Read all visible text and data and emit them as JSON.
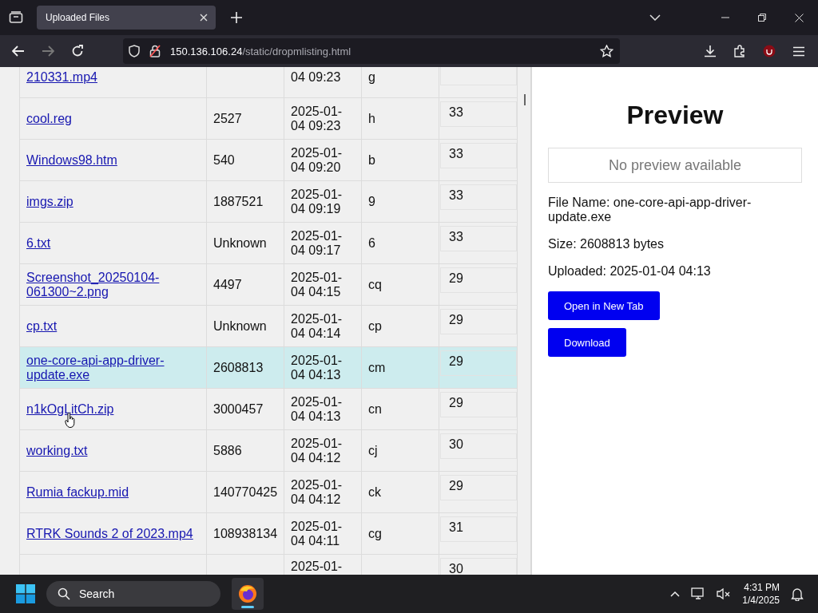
{
  "browser": {
    "tab_title": "Uploaded Files",
    "url_host": "150.136.106.24",
    "url_path": "/static/dropmlisting.html"
  },
  "table": {
    "rows": [
      {
        "name": "210331.mp4",
        "size": "",
        "date": "04 09:23",
        "type": "g",
        "count": "",
        "selected": false
      },
      {
        "name": "cool.reg",
        "size": "2527",
        "date": "2025-01-04 09:23",
        "type": "h",
        "count": "33",
        "selected": false
      },
      {
        "name": "Windows98.htm",
        "size": "540",
        "date": "2025-01-04 09:20",
        "type": "b",
        "count": "33",
        "selected": false
      },
      {
        "name": "imgs.zip",
        "size": "1887521",
        "date": "2025-01-04 09:19",
        "type": "9",
        "count": "33",
        "selected": false
      },
      {
        "name": "6.txt",
        "size": "Unknown",
        "date": "2025-01-04 09:17",
        "type": "6",
        "count": "33",
        "selected": false
      },
      {
        "name": "Screenshot_20250104-061300~2.png",
        "size": "4497",
        "date": "2025-01-04 04:15",
        "type": "cq",
        "count": "29",
        "selected": false
      },
      {
        "name": "cp.txt",
        "size": "Unknown",
        "date": "2025-01-04 04:14",
        "type": "cp",
        "count": "29",
        "selected": false
      },
      {
        "name": "one-core-api-app-driver-update.exe",
        "size": "2608813",
        "date": "2025-01-04 04:13",
        "type": "cm",
        "count": "29",
        "selected": true
      },
      {
        "name": "n1kOgLitCh.zip",
        "size": "3000457",
        "date": "2025-01-04 04:13",
        "type": "cn",
        "count": "29",
        "selected": false
      },
      {
        "name": "working.txt",
        "size": "5886",
        "date": "2025-01-04 04:12",
        "type": "cj",
        "count": "30",
        "selected": false
      },
      {
        "name": "Rumia fackup.mid",
        "size": "140770425",
        "date": "2025-01-04 04:12",
        "type": "ck",
        "count": "29",
        "selected": false
      },
      {
        "name": "RTRK Sounds 2 of 2023.mp4",
        "size": "108938134",
        "date": "2025-01-04 04:11",
        "type": "cg",
        "count": "31",
        "selected": false
      },
      {
        "name": "",
        "size": "",
        "date": "2025-01-",
        "type": "",
        "count": "30",
        "selected": false
      }
    ]
  },
  "preview": {
    "title": "Preview",
    "placeholder": "No preview available",
    "file_name": "File Name: one-core-api-app-driver-update.exe",
    "size": "Size: 2608813 bytes",
    "uploaded": "Uploaded: 2025-01-04 04:13",
    "buttons": [
      "Open in New Tab",
      "Download"
    ]
  },
  "taskbar": {
    "search_placeholder": "Search",
    "time": "4:31 PM",
    "date": "1/4/2025"
  }
}
